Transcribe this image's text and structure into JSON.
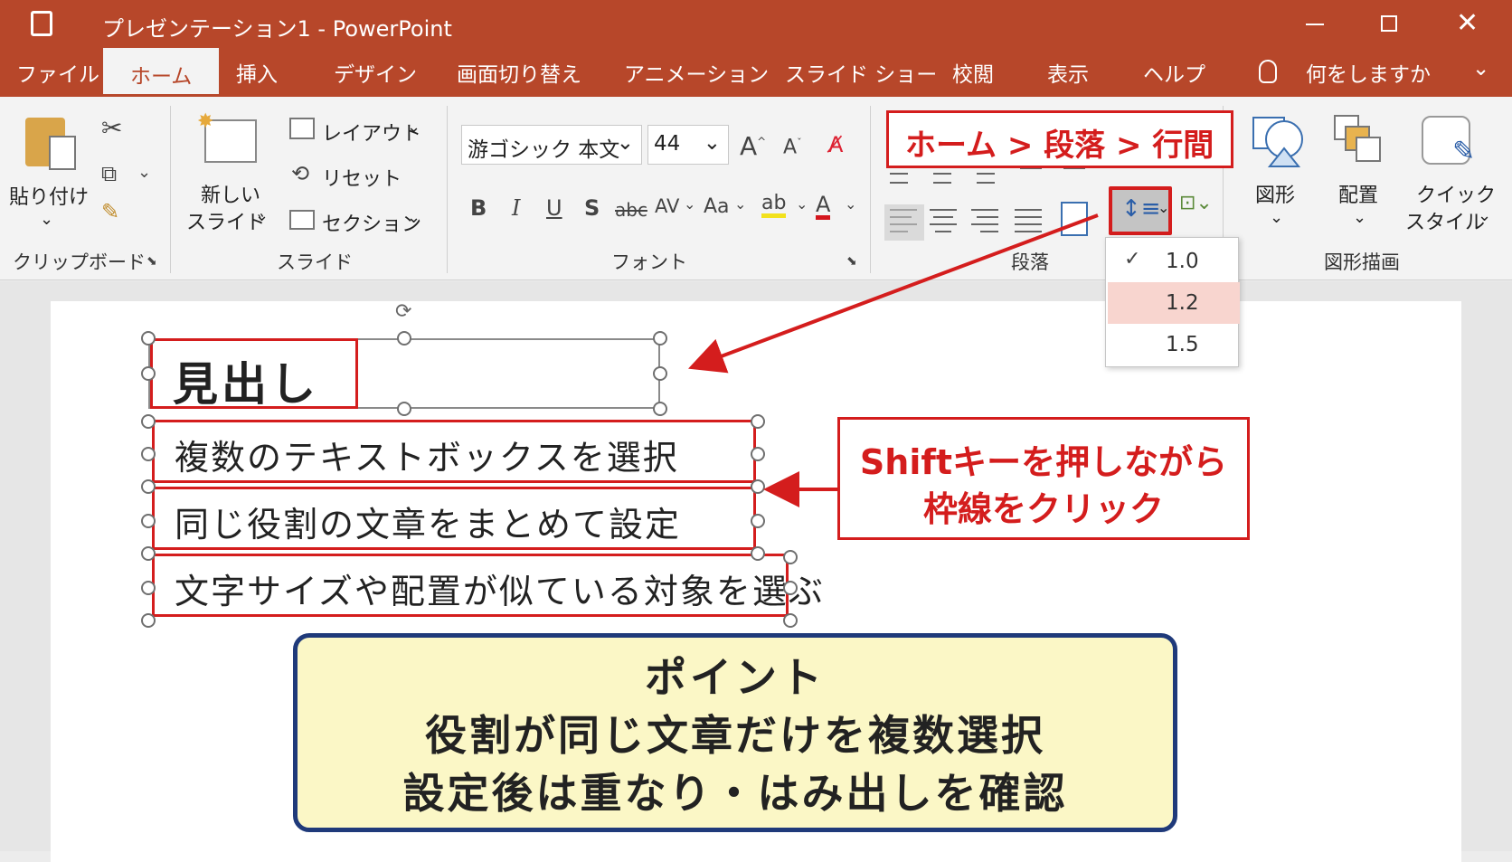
{
  "window": {
    "title": "プレゼンテーション1 - PowerPoint"
  },
  "tabs": [
    "ファイル",
    "ホーム",
    "挿入",
    "デザイン",
    "画面切り替え",
    "アニメーション",
    "スライド ショー",
    "校閲",
    "表示",
    "ヘルプ"
  ],
  "active_tab": "ホーム",
  "tell_me": "何をしますか",
  "ribbon": {
    "clipboard": {
      "paste": "貼り付け",
      "group": "クリップボード"
    },
    "slides": {
      "new_slide_1": "新しい",
      "new_slide_2": "スライド",
      "layout": "レイアウト",
      "reset": "リセット",
      "section": "セクション",
      "group": "スライド"
    },
    "font": {
      "name": "游ゴシック 本文",
      "size": "44",
      "bold": "B",
      "italic": "I",
      "underline": "U",
      "shadow": "S",
      "strike": "abc",
      "spacing": "AV",
      "case": "Aa",
      "group": "フォント"
    },
    "paragraph": {
      "group": "段落"
    },
    "drawing": {
      "shapes": "図形",
      "arrange": "配置",
      "quick_1": "クイック",
      "quick_2": "スタイル",
      "group": "図形描画"
    }
  },
  "line_spacing_dropdown": {
    "items": [
      "1.0",
      "1.2",
      "1.5"
    ],
    "checked": "1.0",
    "hovered": "1.2"
  },
  "callouts": {
    "path": "ホーム > 段落 > 行間",
    "shift_1": "Shiftキーを押しながら",
    "shift_2": "枠線をクリック"
  },
  "slide": {
    "heading": "見出し",
    "rows": [
      "複数のテキストボックスを選択",
      "同じ役割の文章をまとめて設定",
      "文字サイズや配置が似ている対象を選ぶ"
    ]
  },
  "point_box": {
    "title": "ポイント",
    "line1": "役割が同じ文章だけを複数選択",
    "line2": "設定後は重なり・はみ出しを確認"
  },
  "colors": {
    "accent": "#b7472a",
    "callout_red": "#d41d1d",
    "point_bg": "#fbf7c6",
    "point_border": "#1f3a7a",
    "hover": "#f8d5cf"
  }
}
